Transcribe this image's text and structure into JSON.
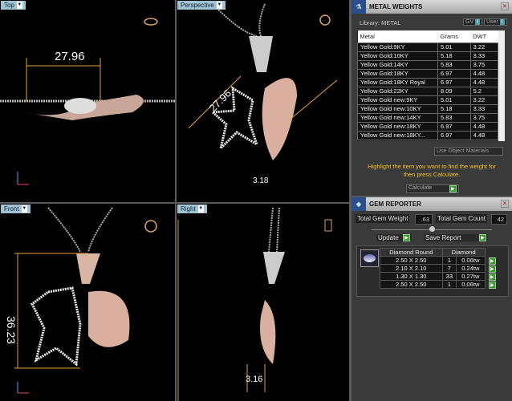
{
  "viewports": [
    {
      "label": "Top",
      "dimension": "27.96"
    },
    {
      "label": "Perspective",
      "dimension": "27.96",
      "dimension2": "3.18"
    },
    {
      "label": "Front",
      "dimension": "36.23"
    },
    {
      "label": "Right",
      "dimension": "3.16"
    }
  ],
  "metal_weights": {
    "title": "METAL WEIGHTS",
    "library": "Library: METAL",
    "gv_label": "GV",
    "user_label": "User",
    "columns": [
      "Metal",
      "Grams",
      "DWT"
    ],
    "rows": [
      [
        "Yellow Gold:9KY",
        "5.01",
        "3.22"
      ],
      [
        "Yellow Gold:10KY",
        "5.18",
        "3.33"
      ],
      [
        "Yellow Gold:14KY",
        "5.83",
        "3.75"
      ],
      [
        "Yellow Gold:18KY",
        "6.97",
        "4.48"
      ],
      [
        "Yellow Gold:18KY Royal",
        "6.97",
        "4.48"
      ],
      [
        "Yellow Gold:22KY",
        "8.09",
        "5.2"
      ],
      [
        "Yellow Gold new:9KY",
        "5.01",
        "3.22"
      ],
      [
        "Yellow Gold new:10KY",
        "5.18",
        "3.33"
      ],
      [
        "Yellow Gold new:14KY",
        "5.83",
        "3.75"
      ],
      [
        "Yellow Gold new:18KY",
        "6.97",
        "4.48"
      ],
      [
        "Yellow Gold new:18KY...",
        "6.97",
        "4.48"
      ]
    ],
    "use_object_materials": "Use Object Materials",
    "hint": "Highlight the item you want to find the weight for then press Calculate.",
    "calculate": "Calculate"
  },
  "gem_reporter": {
    "title": "GEM REPORTER",
    "total_weight_label": "Total Gem Weight",
    "total_weight": ".63",
    "total_count_label": "Total Gem Count",
    "total_count": "42",
    "update": "Update",
    "save_report": "Save Report",
    "headers": [
      "Diamond Round",
      "Diamond"
    ],
    "rows": [
      [
        "2.50 X 2.50",
        "1",
        "0.06tw"
      ],
      [
        "2.10 X 2.10",
        "7",
        "0.24tw"
      ],
      [
        "1.30 X 1.30",
        "33",
        "0.27tw"
      ],
      [
        "2.50 X 2.50",
        "1",
        "0.06tw"
      ]
    ]
  }
}
